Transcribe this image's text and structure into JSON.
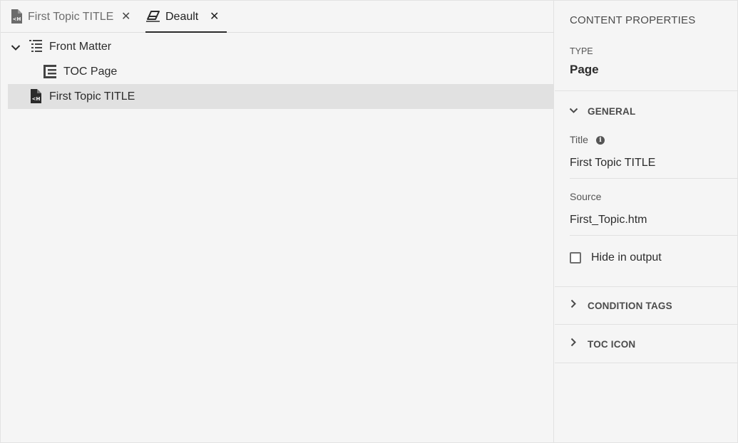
{
  "tabs": [
    {
      "label": "First Topic TITLE",
      "active": false
    },
    {
      "label": "Deault",
      "active": true
    }
  ],
  "tree": {
    "items": [
      {
        "label": "Front Matter",
        "expanded": true
      },
      {
        "label": "TOC Page"
      },
      {
        "label": "First Topic TITLE",
        "selected": true
      }
    ]
  },
  "properties": {
    "title": "CONTENT PROPERTIES",
    "type_label": "TYPE",
    "type_value": "Page",
    "general": {
      "header": "GENERAL",
      "title_label": "Title",
      "title_value": "First Topic TITLE",
      "source_label": "Source",
      "source_value": "First_Topic.htm",
      "hide_label": "Hide in output",
      "hide_checked": false
    },
    "condition_tags": "CONDITION TAGS",
    "toc_icon": "TOC ICON"
  }
}
